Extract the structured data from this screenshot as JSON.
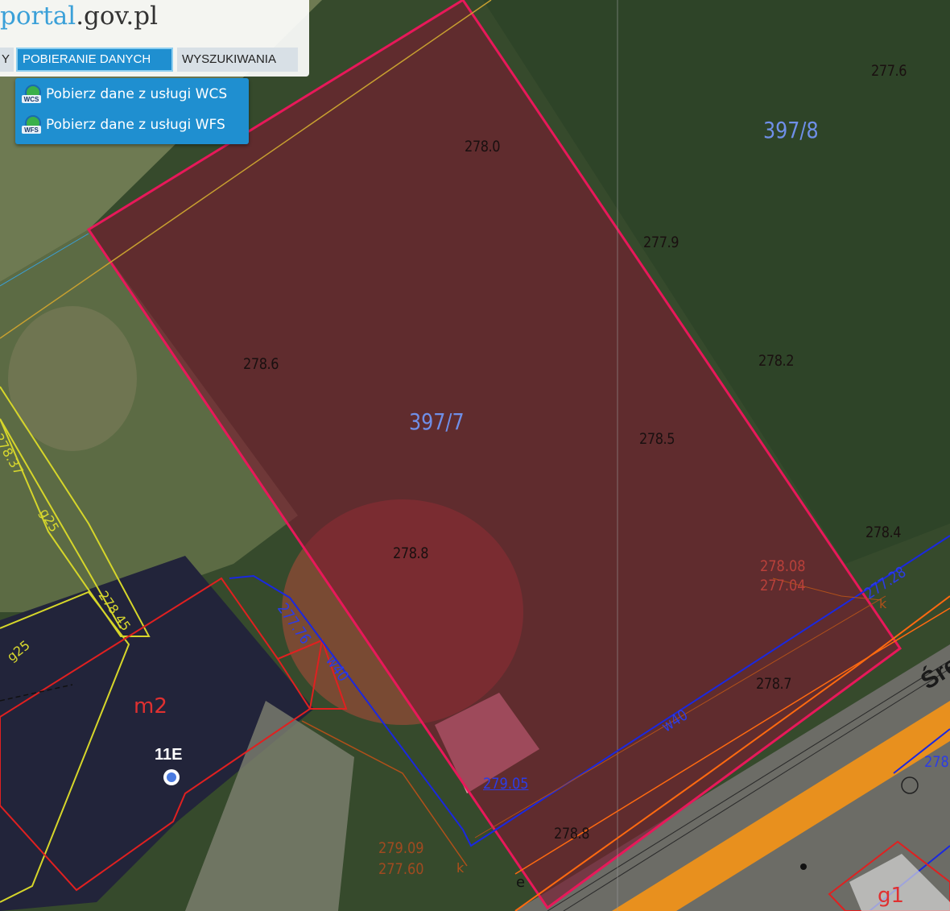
{
  "header": {
    "logo_part1": "portal",
    "logo_part2": ".gov.pl",
    "tabs": [
      {
        "label": "Y"
      },
      {
        "label": "POBIERANIE DANYCH"
      },
      {
        "label": "WYSZUKIWANIA"
      }
    ]
  },
  "dropdown": {
    "items": [
      {
        "label": "Pobierz dane z usługi WCS",
        "icon": "WCS"
      },
      {
        "label": "Pobierz dane z usługi WFS",
        "icon": "WFS"
      }
    ]
  },
  "map": {
    "parcels": {
      "main": "397/7",
      "neighbor": "397/8"
    },
    "elevations": [
      "277.6",
      "278.0",
      "277.9",
      "278.6",
      "278.2",
      "278.5",
      "278.8",
      "278.4",
      "278.7",
      "278.8"
    ],
    "red_labels": [
      "278.08",
      "277.04",
      "279.09",
      "277.60"
    ],
    "blue_labels": [
      "279.05",
      "277.76",
      "w40",
      "w40",
      "277.28",
      "278"
    ],
    "yellow_labels": [
      "278.37",
      "g25",
      "278.45",
      "g25"
    ],
    "other_labels": [
      "m2",
      "11E",
      "g1",
      "Śre",
      "k",
      "k",
      "e"
    ],
    "colors": {
      "parcel_outline": "#e8185a",
      "parcel_fill": "#7a1a30",
      "blue_line": "#1a28e0",
      "yellow_line": "#d6d62a",
      "orange_road": "#f08a1a",
      "red_building": "#e02020"
    }
  }
}
